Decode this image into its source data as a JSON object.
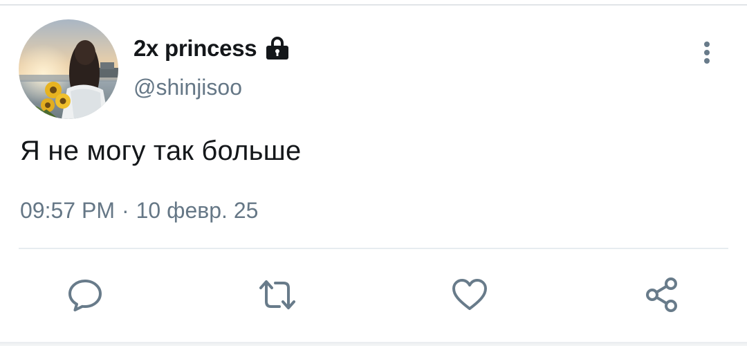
{
  "tweet": {
    "display_name": "2x princess",
    "protected_icon": "lock-icon",
    "handle": "@shinjisoo",
    "text": "Я не могу так больше",
    "time": "09:57 PM",
    "separator": "·",
    "date": "10 февр. 25"
  },
  "icons": {
    "more": "more-vertical-icon",
    "reply": "comment-icon",
    "retweet": "retweet-icon",
    "like": "heart-icon",
    "share": "share-icon"
  },
  "colors": {
    "text_primary": "#14171a",
    "text_secondary": "#657786",
    "icon": "#687b8a",
    "divider": "#e6ecf0"
  }
}
